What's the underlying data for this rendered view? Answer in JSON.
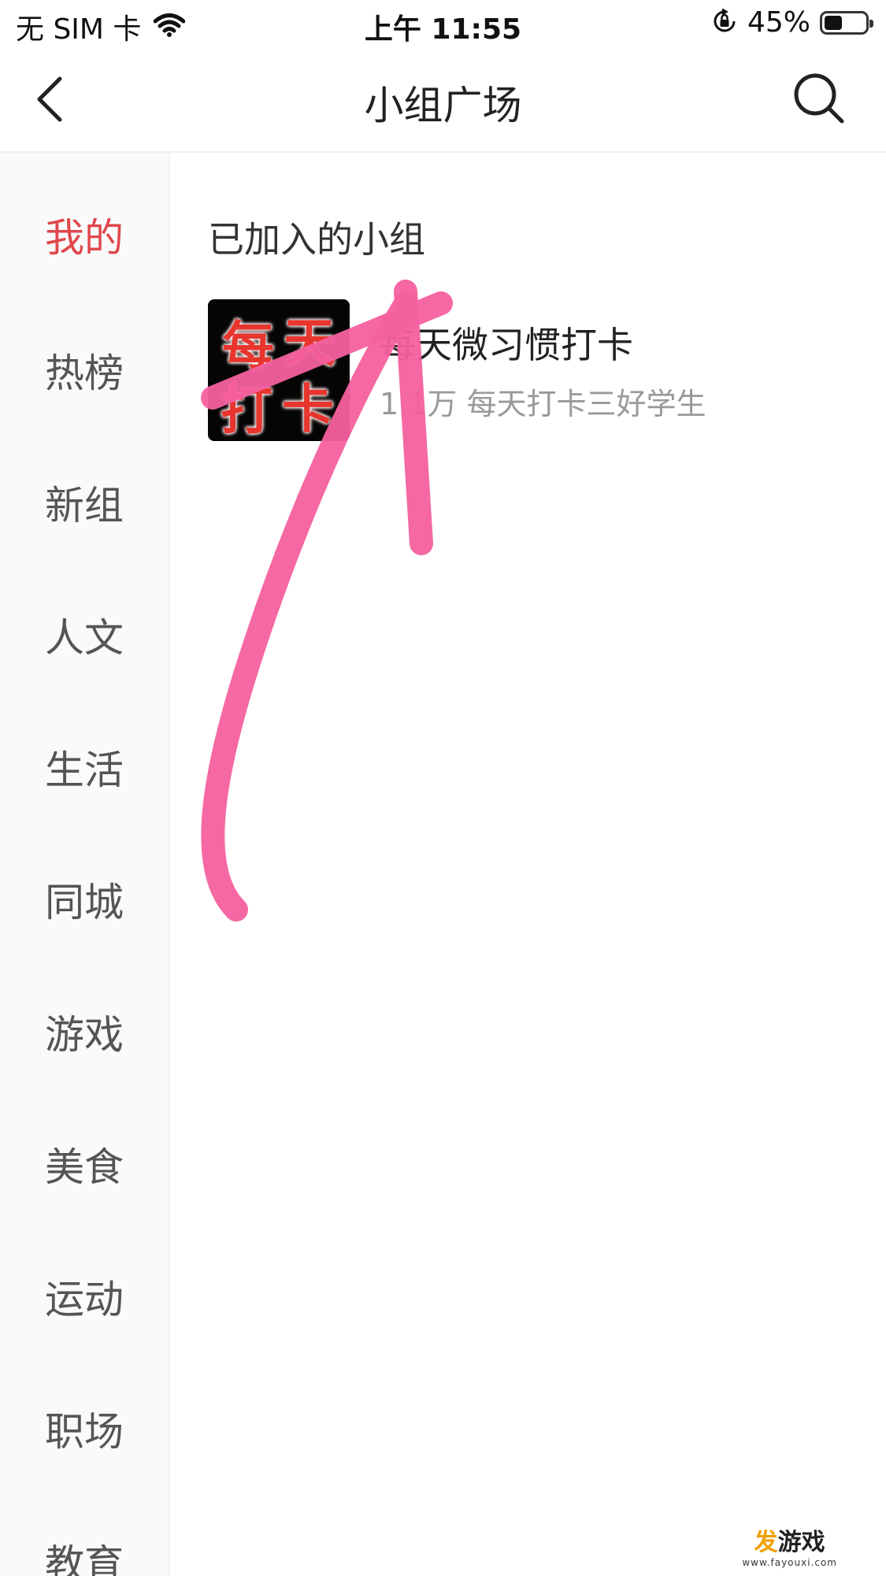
{
  "status_bar": {
    "carrier": "无 SIM 卡",
    "time": "上午 11:55",
    "battery": "45%",
    "battery_level": 0.45
  },
  "nav": {
    "title": "小组广场",
    "back_icon": "chevron-left-icon",
    "search_icon": "search-icon"
  },
  "sidebar": {
    "items": [
      {
        "label": "我的",
        "active": true
      },
      {
        "label": "热榜",
        "active": false
      },
      {
        "label": "新组",
        "active": false
      },
      {
        "label": "人文",
        "active": false
      },
      {
        "label": "生活",
        "active": false
      },
      {
        "label": "同城",
        "active": false
      },
      {
        "label": "游戏",
        "active": false
      },
      {
        "label": "美食",
        "active": false
      },
      {
        "label": "运动",
        "active": false
      },
      {
        "label": "职场",
        "active": false
      },
      {
        "label": "教育",
        "active": false
      }
    ]
  },
  "content": {
    "section_title": "已加入的小组",
    "groups": [
      {
        "avatar_text": [
          "每",
          "天",
          "打",
          "卡"
        ],
        "name": "每天微习惯打卡",
        "desc": "1.1万 每天打卡三好学生"
      }
    ]
  },
  "watermark": {
    "main": "发游戏",
    "url": "www.fayouxi.com"
  },
  "colors": {
    "active": "#e0474c",
    "annotation": "#f4609e"
  }
}
